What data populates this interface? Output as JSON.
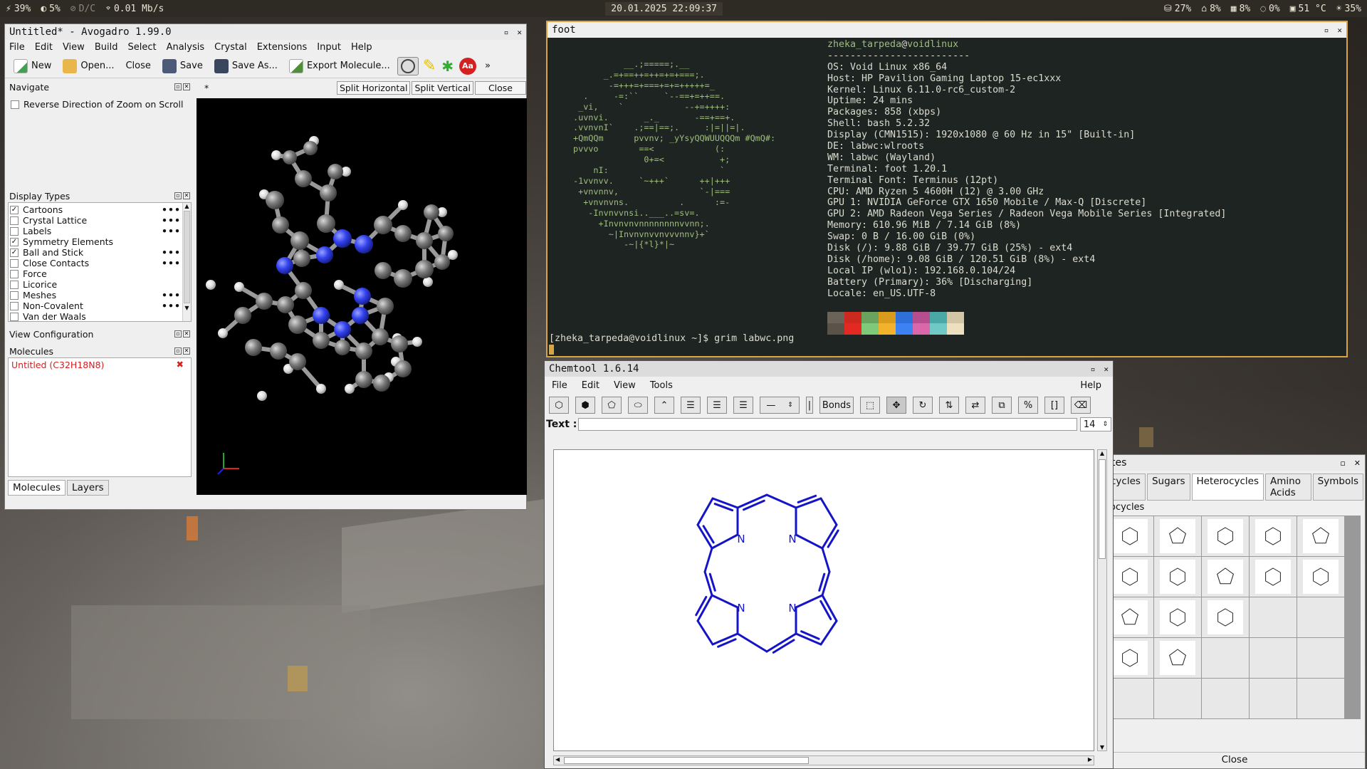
{
  "statusbar": {
    "left": [
      {
        "icon": "cpu-icon",
        "text": "39%"
      },
      {
        "icon": "mem-icon",
        "text": "5%"
      },
      {
        "icon": "battery-icon",
        "text": "D/C"
      },
      {
        "icon": "wifi-icon",
        "text": "0.01 Mb/s"
      }
    ],
    "clock": "20.01.2025 22:09:37",
    "right": [
      {
        "icon": "disk-icon",
        "text": "27%"
      },
      {
        "icon": "home-disk-icon",
        "text": "8%"
      },
      {
        "icon": "cpu-load-icon",
        "text": "8%"
      },
      {
        "icon": "temp-icon",
        "text": "0%"
      },
      {
        "icon": "gpu-icon",
        "text": "51 °C"
      },
      {
        "icon": "brightness-icon",
        "text": "35%"
      }
    ]
  },
  "avogadro": {
    "title": "Untitled* - Avogadro 1.99.0",
    "menu": [
      "File",
      "Edit",
      "View",
      "Build",
      "Select",
      "Analysis",
      "Crystal",
      "Extensions",
      "Input",
      "Help"
    ],
    "toolbar": {
      "new": "New",
      "open": "Open...",
      "close": "Close",
      "save": "Save",
      "save_as": "Save As...",
      "export": "Export Molecule...",
      "more": "»"
    },
    "navigate": {
      "title": "Navigate",
      "option": "Reverse Direction of Zoom on Scroll"
    },
    "display_types": {
      "title": "Display Types",
      "items": [
        {
          "label": "Cartoons",
          "checked": true,
          "dots": true
        },
        {
          "label": "Crystal Lattice",
          "checked": false,
          "dots": true
        },
        {
          "label": "Labels",
          "checked": false,
          "dots": true
        },
        {
          "label": "Symmetry Elements",
          "checked": true,
          "dots": false
        },
        {
          "label": "Ball and Stick",
          "checked": true,
          "dots": true
        },
        {
          "label": "Close Contacts",
          "checked": false,
          "dots": true
        },
        {
          "label": "Force",
          "checked": false,
          "dots": false
        },
        {
          "label": "Licorice",
          "checked": false,
          "dots": false
        },
        {
          "label": "Meshes",
          "checked": false,
          "dots": true
        },
        {
          "label": "Non-Covalent",
          "checked": false,
          "dots": true
        },
        {
          "label": "Van der Waals",
          "checked": false,
          "dots": false
        }
      ]
    },
    "view_config": "View Configuration",
    "molecules": {
      "title": "Molecules",
      "item": "Untitled (C32H18N8)"
    },
    "tabs": [
      "Molecules",
      "Layers"
    ],
    "view": {
      "tab": "*",
      "split_h": "Split Horizontal",
      "split_v": "Split Vertical",
      "close": "Close"
    }
  },
  "foot": {
    "title": "foot",
    "user": "zheka_tarpeda",
    "at": "@",
    "host": "voidlinux",
    "separator": "-------------------------",
    "info": [
      [
        "OS:",
        " Void Linux x86_64"
      ],
      [
        "Host:",
        " HP Pavilion Gaming Laptop 15-ec1xxx"
      ],
      [
        "Kernel:",
        " Linux 6.11.0-rc6_custom-2"
      ],
      [
        "Uptime:",
        " 24 mins"
      ],
      [
        "Packages:",
        " 858 (xbps)"
      ],
      [
        "Shell:",
        " bash 5.2.32"
      ],
      [
        "Display (CMN1515):",
        " 1920x1080 @ 60 Hz in 15\" [Built-in]"
      ],
      [
        "DE:",
        " labwc:wlroots"
      ],
      [
        "WM:",
        " labwc (Wayland)"
      ],
      [
        "Terminal:",
        " foot 1.20.1"
      ],
      [
        "Terminal Font:",
        " Terminus (12pt)"
      ],
      [
        "CPU:",
        " AMD Ryzen 5 4600H (12) @ 3.00 GHz"
      ],
      [
        "GPU 1:",
        " NVIDIA GeForce GTX 1650 Mobile / Max-Q [Discrete]"
      ],
      [
        "GPU 2:",
        " AMD Radeon Vega Series / Radeon Vega Mobile Series [Integrated]"
      ],
      [
        "Memory:",
        " 610.96 MiB / 7.14 GiB (8%)"
      ],
      [
        "Swap:",
        " 0 B / 16.00 GiB (0%)"
      ],
      [
        "Disk (/):",
        " 9.88 GiB / 39.77 GiB (25%) - ext4"
      ],
      [
        "Disk (/home):",
        " 9.08 GiB / 120.51 GiB (8%) - ext4"
      ],
      [
        "Local IP (wlo1):",
        " 192.168.0.104/24"
      ],
      [
        "Battery (Primary):",
        " 36% [Discharging]"
      ],
      [
        "Locale:",
        " en_US.UTF-8"
      ]
    ],
    "logo": [
      "          __.;=====;.__",
      "      _.=+==++=++=+=+===;.",
      "       -=+++=+===+=+=+++++=_",
      "  .     -=:``     `--==+=++==.",
      " _vi,    `            --+=++++:",
      ".uvnvi.       _._       -==+==+.",
      ".vvnvnI`    .;==|==;.     :|=||=|.",
      "+QmQQm      pvvnv; _yYsyQQWUUQQQm #QmQ#:",
      "pvvvo        ==<            (:",
      "              0+=<           +;",
      "    nI:                      `",
      "-1vvnvv.     `~+++`      ++|+++",
      " +vnvnnv,                `-|===",
      "  +vnvnvns.          .      :=-",
      "   -Invnvvnsi..___..=sv=.",
      "     +Invnvnvnnnnnnnnvvnn;.",
      "       ~|Invnvnvvnvvvnnv}+`",
      "          -~|{*l}*|~"
    ],
    "palette": [
      "#6b6258",
      "#cc2a1e",
      "#6aa35d",
      "#d89b1c",
      "#2f6fd8",
      "#b54d8f",
      "#4aa8a6",
      "#d3c6a6",
      "#5b5249",
      "#e32a22",
      "#7fc97a",
      "#f3b22b",
      "#3d82f3",
      "#d967a9",
      "#6fc9c5",
      "#ece0c0"
    ],
    "prompt": "[zheka_tarpeda@voidlinux ~]$ grim labwc.png"
  },
  "chemtool": {
    "title": "Chemtool 1.6.14",
    "menu": [
      "File",
      "Edit",
      "View",
      "Tools"
    ],
    "help": "Help",
    "bonds_btn": "Bonds",
    "text_label": "Text :",
    "text_value": "",
    "font_size": "14",
    "atom_label": "N"
  },
  "templates": {
    "title": "tes",
    "tabs": [
      "cycles",
      "Sugars",
      "Heterocycles",
      "Amino Acids",
      "Symbols"
    ],
    "active_tab": "Heterocycles",
    "sublabel": "ocycles",
    "close": "Close"
  }
}
